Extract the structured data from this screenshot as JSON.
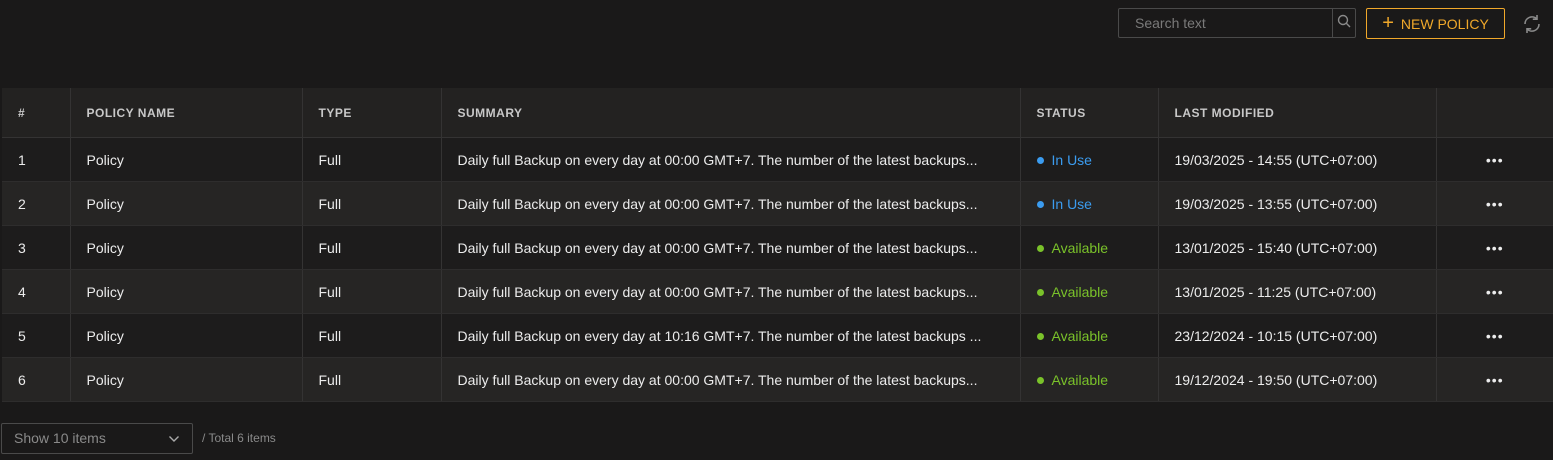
{
  "toolbar": {
    "search_placeholder": "Search text",
    "search_icon": "search-icon",
    "new_policy_label": "NEW POLICY",
    "refresh_icon": "refresh-icon",
    "accent_color": "#f0a82a"
  },
  "table": {
    "columns": [
      "#",
      "POLICY NAME",
      "TYPE",
      "SUMMARY",
      "STATUS",
      "LAST MODIFIED",
      ""
    ],
    "rows": [
      {
        "num": "1",
        "name": "Policy",
        "type": "Full",
        "summary": "Daily full Backup on every day at 00:00 GMT+7. The number of the latest backups...",
        "status": "In Use",
        "status_color": "#3b9cf0",
        "modified": "19/03/2025 - 14:55 (UTC+07:00)"
      },
      {
        "num": "2",
        "name": "Policy",
        "type": "Full",
        "summary": "Daily full Backup on every day at 00:00 GMT+7. The number of the latest backups...",
        "status": "In Use",
        "status_color": "#3b9cf0",
        "modified": "19/03/2025 - 13:55 (UTC+07:00)"
      },
      {
        "num": "3",
        "name": "Policy",
        "type": "Full",
        "summary": "Daily full Backup on every day at 00:00 GMT+7. The number of the latest backups...",
        "status": "Available",
        "status_color": "#7ac22a",
        "modified": "13/01/2025 - 15:40 (UTC+07:00)"
      },
      {
        "num": "4",
        "name": "Policy",
        "type": "Full",
        "summary": "Daily full Backup on every day at 00:00 GMT+7. The number of the latest backups...",
        "status": "Available",
        "status_color": "#7ac22a",
        "modified": "13/01/2025 - 11:25 (UTC+07:00)"
      },
      {
        "num": "5",
        "name": "Policy",
        "type": "Full",
        "summary": "Daily full Backup on every day at 10:16 GMT+7. The number of the latest backups ...",
        "status": "Available",
        "status_color": "#7ac22a",
        "modified": "23/12/2024 - 10:15 (UTC+07:00)"
      },
      {
        "num": "6",
        "name": "Policy",
        "type": "Full",
        "summary": "Daily full Backup on every day at 00:00 GMT+7. The number of the latest backups...",
        "status": "Available",
        "status_color": "#7ac22a",
        "modified": "19/12/2024 - 19:50 (UTC+07:00)"
      }
    ],
    "row_action_icon": "more-horizontal-icon",
    "row_action_glyph": "•••"
  },
  "footer": {
    "page_size_label": "Show 10 items",
    "total_label": "/ Total 6 items",
    "dropdown_icon": "chevron-down-icon"
  }
}
